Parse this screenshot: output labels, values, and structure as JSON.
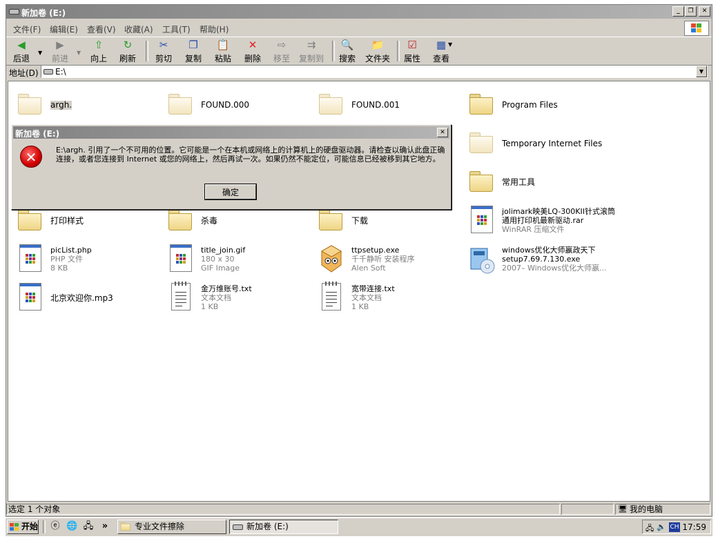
{
  "window": {
    "title": "新加卷 (E:)"
  },
  "menu": [
    "文件(F)",
    "编辑(E)",
    "查看(V)",
    "收藏(A)",
    "工具(T)",
    "帮助(H)"
  ],
  "toolbar": {
    "back": "后退",
    "forward": "前进",
    "up": "向上",
    "refresh": "刷新",
    "cut": "剪切",
    "copy": "复制",
    "paste": "粘贴",
    "delete": "删除",
    "moveto": "移至",
    "copyto": "复制到",
    "search": "搜索",
    "folders": "文件夹",
    "properties": "属性",
    "views": "查看"
  },
  "address": {
    "label": "地址(D)",
    "value": "E:\\"
  },
  "items": [
    {
      "name": "argh.",
      "type": "folder"
    },
    {
      "name": "FOUND.000",
      "type": "folder"
    },
    {
      "name": "FOUND.001",
      "type": "folder"
    },
    {
      "name": "Program Files",
      "type": "folder"
    },
    {
      "name": "Temporary Internet Files",
      "type": "folder"
    },
    {
      "name": "常用工具",
      "type": "folder"
    },
    {
      "name": "打印样式",
      "type": "folder"
    },
    {
      "name": "杀毒",
      "type": "folder"
    },
    {
      "name": "下载",
      "type": "folder"
    },
    {
      "name": "jolimark映美LQ-300KII针式滚筒",
      "name2": "通用打印机最新驱动.rar",
      "sub1": "WinRAR 压缩文件"
    },
    {
      "name": "picList.php",
      "sub1": "PHP 文件",
      "sub2": "8 KB"
    },
    {
      "name": "title_join.gif",
      "sub1": "180 x 30",
      "sub2": "GIF Image"
    },
    {
      "name": "ttpsetup.exe",
      "sub1": "千千静听 安装程序",
      "sub2": "Alen Soft"
    },
    {
      "name": "windows优化大师嬴政天下",
      "name2": "setup7.69.7.130.exe",
      "sub1": "2007– Windows优化大师嬴..."
    },
    {
      "name": "北京欢迎你.mp3"
    },
    {
      "name": "金万维账号.txt",
      "sub1": "文本文档",
      "sub2": "1 KB"
    },
    {
      "name": "宽带连接.txt",
      "sub1": "文本文档",
      "sub2": "1 KB"
    }
  ],
  "dialog": {
    "title": "新加卷 (E:)",
    "message": "E:\\argh. 引用了一个不可用的位置。它可能是一个在本机或网络上的计算机上的硬盘驱动器。请检查以确认此盘正确连接，或者您连接到 Internet 或您的网络上，然后再试一次。如果仍然不能定位，可能信息已经被移到其它地方。",
    "ok": "确定"
  },
  "status": {
    "selected": "选定 1 个对象",
    "location": "我的电脑"
  },
  "taskbar": {
    "start": "开始",
    "tasks": [
      "专业文件擦除",
      "新加卷 (E:)"
    ],
    "tray_lang": "CH",
    "clock": "17:59"
  }
}
